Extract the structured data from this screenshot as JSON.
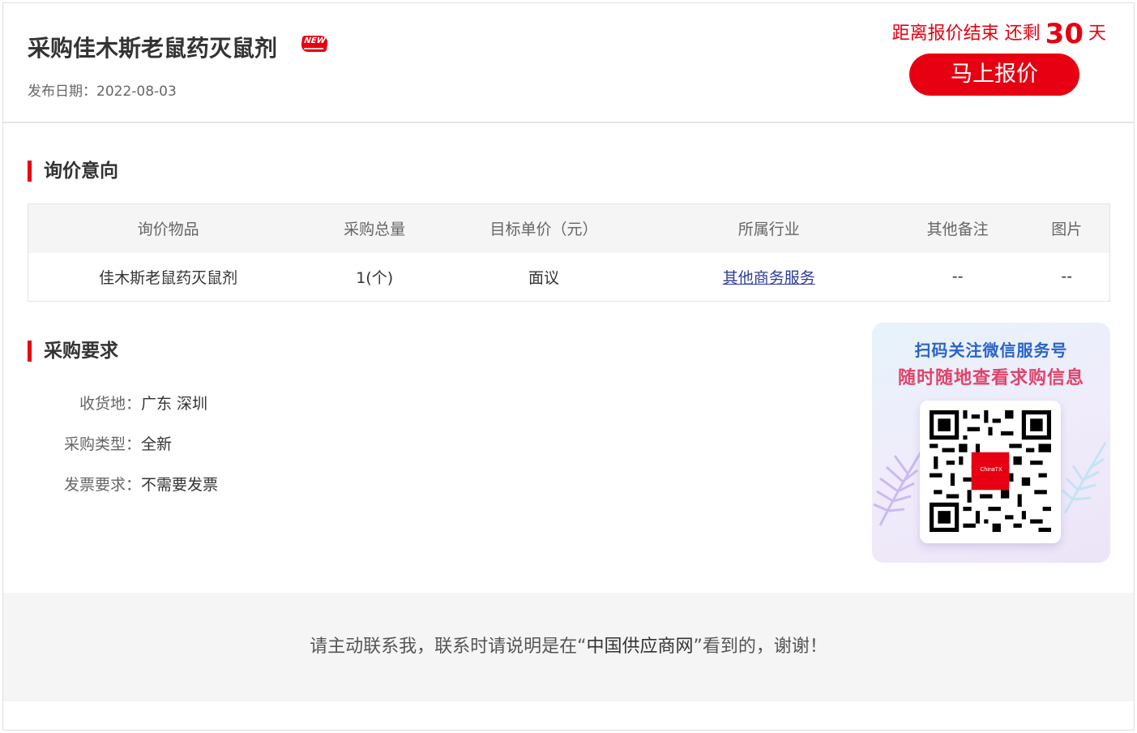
{
  "header": {
    "title": "采购佳木斯老鼠药灭鼠剂",
    "new_badge": "NEW",
    "publish_label": "发布日期：",
    "publish_date": "2022-08-03",
    "countdown_prefix": "距离报价结束 还剩",
    "countdown_days": "30",
    "countdown_unit": "天",
    "quote_button": "马上报价"
  },
  "inquiry": {
    "heading": "询价意向",
    "columns": [
      "询价物品",
      "采购总量",
      "目标单价（元）",
      "所属行业",
      "其他备注",
      "图片"
    ],
    "rows": [
      {
        "item": "佳木斯老鼠药灭鼠剂",
        "quantity": "1(个)",
        "price": "面议",
        "industry": "其他商务服务",
        "remark": "--",
        "image": "--"
      }
    ]
  },
  "requirements": {
    "heading": "采购要求",
    "items": [
      {
        "key": "收货地：",
        "value": "广东 深圳"
      },
      {
        "key": "采购类型：",
        "value": "全新"
      },
      {
        "key": "发票要求：",
        "value": "不需要发票"
      }
    ]
  },
  "qr": {
    "line1": "扫码关注微信服务号",
    "line2": "随时随地查看求购信息",
    "center_logo": "ChinaTX"
  },
  "footer": {
    "text_before": "请主动联系我，联系时请说明是在“",
    "highlight": "中国供应商网",
    "text_after": "”看到的，谢谢！"
  },
  "colors": {
    "accent": "#e60012",
    "link": "#2f3d9b",
    "qr_blue": "#2a64c9",
    "qr_pink": "#e0436a"
  }
}
